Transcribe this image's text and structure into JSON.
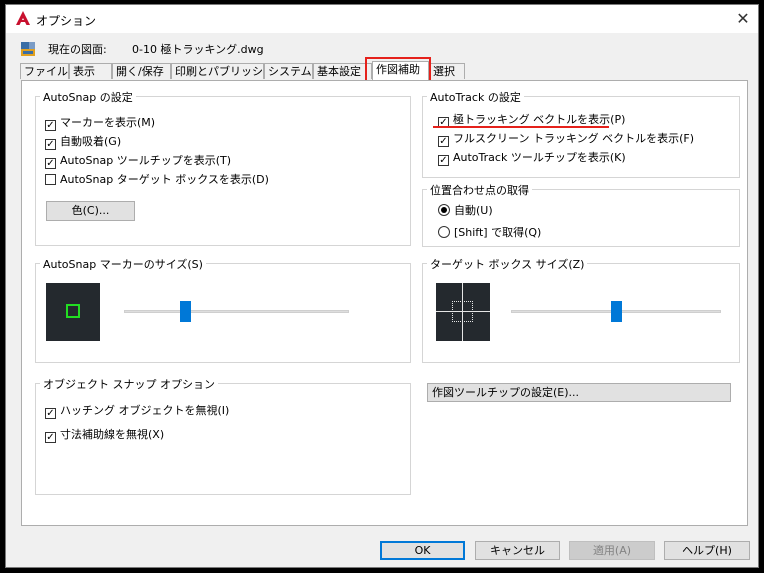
{
  "window": {
    "title": "オプション",
    "close_glyph": "✕"
  },
  "drawing": {
    "label": "現在の図面:",
    "name": "0-10 極トラッキング.dwg"
  },
  "tabs": [
    {
      "label": "ファイル"
    },
    {
      "label": "表示"
    },
    {
      "label": "開く/保存"
    },
    {
      "label": "印刷とパブリッシュ"
    },
    {
      "label": "システム"
    },
    {
      "label": "基本設定"
    },
    {
      "label": "作図補助",
      "active": true
    },
    {
      "label": "選択"
    }
  ],
  "autosnap": {
    "title": "AutoSnap の設定",
    "options": [
      {
        "label": "マーカーを表示(M)",
        "checked": true
      },
      {
        "label": "自動吸着(G)",
        "checked": true
      },
      {
        "label": "AutoSnap ツールチップを表示(T)",
        "checked": true
      },
      {
        "label": "AutoSnap ターゲット ボックスを表示(D)",
        "checked": false
      }
    ],
    "color_button": "色(C)..."
  },
  "autotrack": {
    "title": "AutoTrack の設定",
    "options": [
      {
        "label": "極トラッキング ベクトルを表示(P)",
        "checked": true
      },
      {
        "label": "フルスクリーン トラッキング ベクトルを表示(F)",
        "checked": true
      },
      {
        "label": "AutoTrack ツールチップを表示(K)",
        "checked": true
      }
    ]
  },
  "alignment": {
    "title": "位置合わせ点の取得",
    "options": [
      {
        "label": "自動(U)",
        "selected": true
      },
      {
        "label": "[Shift] で取得(Q)",
        "selected": false
      }
    ]
  },
  "marker_size": {
    "title": "AutoSnap マーカーのサイズ(S)",
    "slider_fraction": 0.27
  },
  "target_box_size": {
    "title": "ターゲット ボックス サイズ(Z)",
    "slider_fraction": 0.5
  },
  "object_snap": {
    "title": "オブジェクト スナップ オプション",
    "options": [
      {
        "label": "ハッチング オブジェクトを無視(I)",
        "checked": true
      },
      {
        "label": "寸法補助線を無視(X)",
        "checked": true
      }
    ]
  },
  "tooltip_settings_button": "作図ツールチップの設定(E)...",
  "buttons": {
    "ok": "OK",
    "cancel": "キャンセル",
    "apply": "適用(A)",
    "help": "ヘルプ(H)"
  },
  "colors": {
    "highlight_red": "#e5211b",
    "accent_blue": "#0078d7",
    "marker_green": "#22dd22",
    "preview_bg": "#24292e"
  },
  "check_glyph": "✓"
}
